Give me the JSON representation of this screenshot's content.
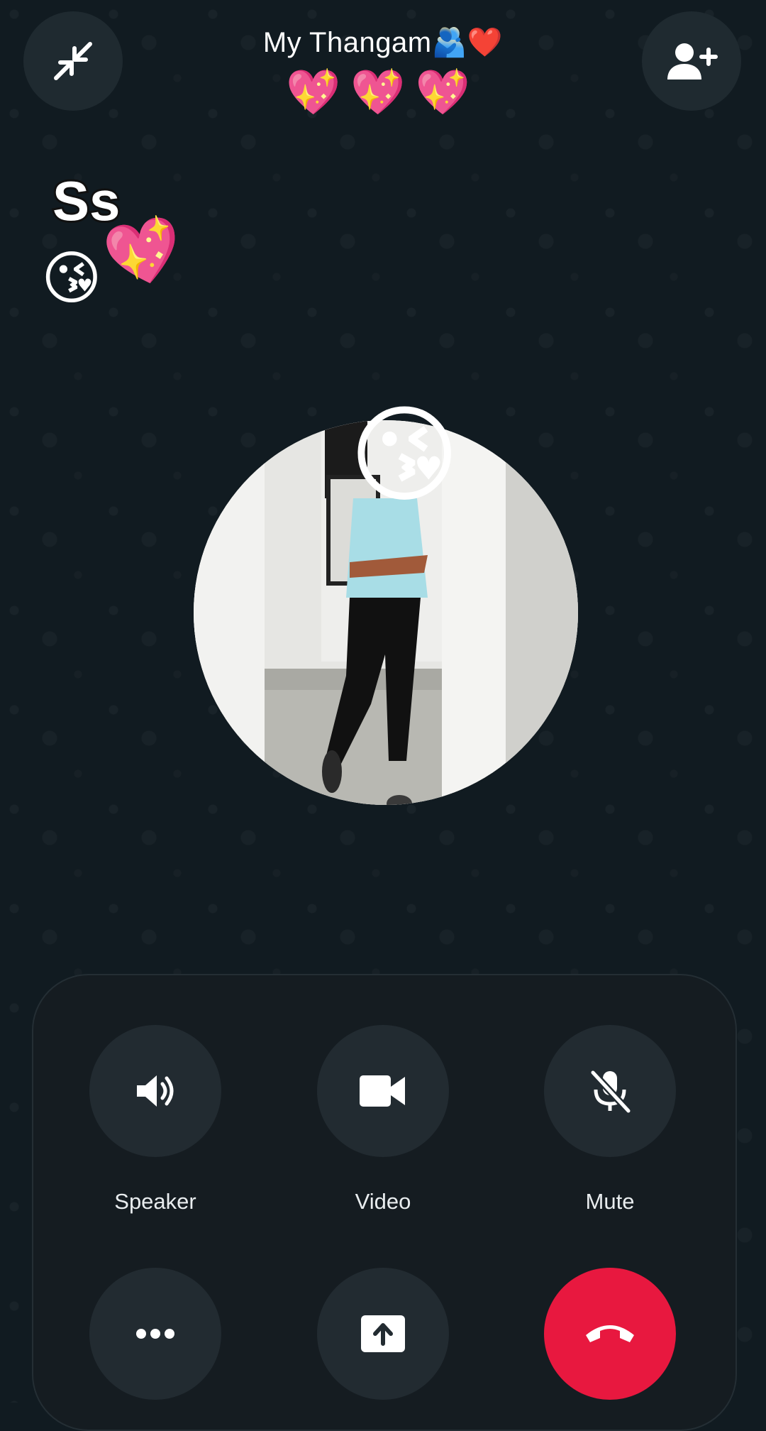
{
  "call": {
    "contact_name": "My Thangam🫂❤️",
    "title_emojis": "💖💖💖",
    "sticker_text": "Ss",
    "sticker_emoji_kiss": "😘",
    "sticker_emoji_heart": "💖",
    "avatar_face_emoji": "😘"
  },
  "controls": {
    "speaker_label": "Speaker",
    "video_label": "Video",
    "mute_label": "Mute"
  },
  "icons": {
    "minimize": "minimize-icon",
    "add_person": "add-person-icon",
    "speaker": "speaker-icon",
    "video": "video-icon",
    "mute": "mic-off-icon",
    "more": "more-icon",
    "share": "share-screen-icon",
    "end_call": "end-call-icon"
  },
  "colors": {
    "background": "#111b21",
    "panel": "#151c21",
    "button": "#222b31",
    "end_call": "#e8183f"
  }
}
